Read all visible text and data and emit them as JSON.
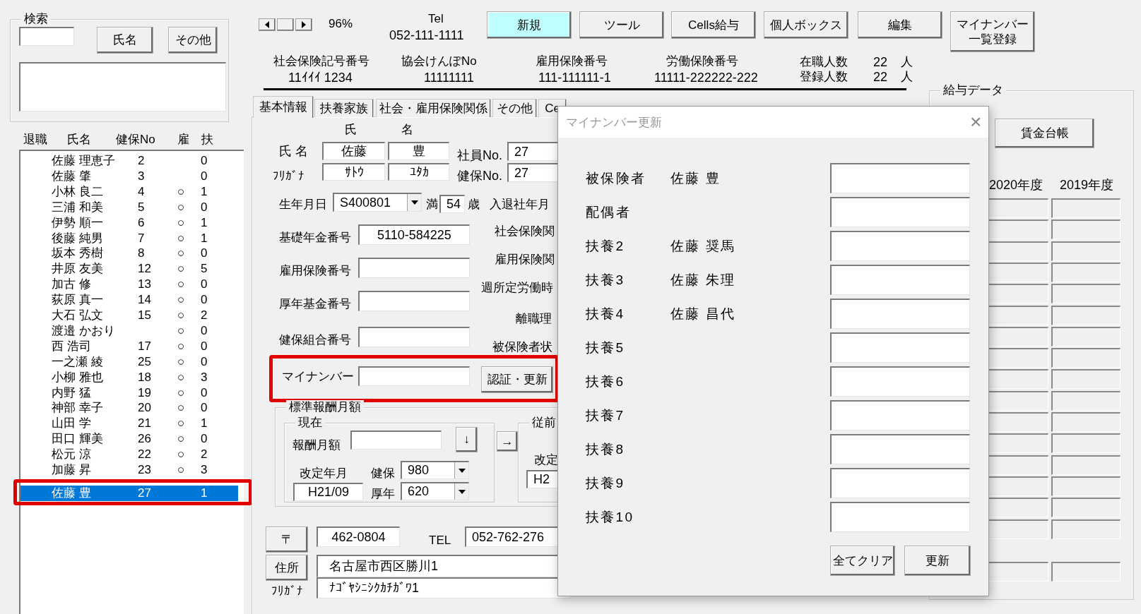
{
  "search": {
    "title": "検索",
    "buttons": [
      "氏名",
      "その他"
    ]
  },
  "employee_list": {
    "columns": [
      "退職",
      "氏名",
      "健保No",
      "雇",
      "扶"
    ],
    "rows": [
      {
        "name": "佐藤 理恵子",
        "kenpo_no": "2",
        "fuyo": "0",
        "selected": false
      },
      {
        "name": "佐藤 肇",
        "kenpo_no": "3",
        "fuyo": "0",
        "selected": false
      },
      {
        "name": "小林 良二",
        "kenpo_no": "4",
        "koyo": "○",
        "fuyo": "1",
        "selected": false
      },
      {
        "name": "三浦 和美",
        "kenpo_no": "5",
        "koyo": "○",
        "fuyo": "0",
        "selected": false
      },
      {
        "name": "伊勢 順一",
        "kenpo_no": "6",
        "koyo": "○",
        "fuyo": "1",
        "selected": false
      },
      {
        "name": "後藤 純男",
        "kenpo_no": "7",
        "koyo": "○",
        "fuyo": "1",
        "selected": false
      },
      {
        "name": "坂本 秀樹",
        "kenpo_no": "8",
        "koyo": "○",
        "fuyo": "0",
        "selected": false
      },
      {
        "name": "井原 友美",
        "kenpo_no": "12",
        "koyo": "○",
        "fuyo": "5",
        "selected": false
      },
      {
        "name": "加古 修",
        "kenpo_no": "13",
        "koyo": "○",
        "fuyo": "0",
        "selected": false
      },
      {
        "name": "荻原 真一",
        "kenpo_no": "14",
        "koyo": "○",
        "fuyo": "0",
        "selected": false
      },
      {
        "name": "大石 弘文",
        "kenpo_no": "15",
        "koyo": "○",
        "fuyo": "2",
        "selected": false
      },
      {
        "name": "渡邉 かおり",
        "koyo": "○",
        "fuyo": "0",
        "selected": false
      },
      {
        "name": "西 浩司",
        "kenpo_no": "17",
        "koyo": "○",
        "fuyo": "0",
        "selected": false
      },
      {
        "name": "一之瀬 綾",
        "kenpo_no": "25",
        "koyo": "○",
        "fuyo": "0",
        "selected": false
      },
      {
        "name": "小柳 雅也",
        "kenpo_no": "18",
        "koyo": "○",
        "fuyo": "3",
        "selected": false
      },
      {
        "name": "内野 猛",
        "kenpo_no": "19",
        "koyo": "○",
        "fuyo": "0",
        "selected": false
      },
      {
        "name": "神部 幸子",
        "kenpo_no": "20",
        "koyo": "○",
        "fuyo": "0",
        "selected": false
      },
      {
        "name": "山田 学",
        "kenpo_no": "21",
        "koyo": "○",
        "fuyo": "1",
        "selected": false
      },
      {
        "name": "田口 輝美",
        "kenpo_no": "26",
        "koyo": "○",
        "fuyo": "0",
        "selected": false
      },
      {
        "name": "松元 涼",
        "kenpo_no": "22",
        "koyo": "○",
        "fuyo": "2",
        "selected": false
      },
      {
        "name": "加藤 昇",
        "kenpo_no": "23",
        "koyo": "○",
        "fuyo": "3",
        "selected": false
      },
      {
        "name": "佐藤 豊",
        "kenpo_no": "27",
        "fuyo": "1",
        "selected": true
      }
    ]
  },
  "toolbar": {
    "zoom": "96%",
    "tel_label": "Tel",
    "tel": "052-111-1111",
    "buttons": [
      {
        "label": "新規",
        "highlighted": true
      },
      {
        "label": "ツール",
        "highlighted": false
      },
      {
        "label": "Cells給与",
        "highlighted": false
      },
      {
        "label": "個人ボックス",
        "highlighted": false
      },
      {
        "label": "編集",
        "highlighted": false
      },
      {
        "lines": [
          "マイナンバー",
          "一覧登録"
        ],
        "highlighted": false
      }
    ]
  },
  "insurance_info": [
    {
      "label": "社会保険記号番号",
      "value": "11ｲｲｲ 1234"
    },
    {
      "label": "協会けんぽNo",
      "value": "11111111"
    },
    {
      "label": "雇用保険番号",
      "value": "111-111111-1"
    },
    {
      "label": "労働保険番号",
      "value": "11111-222222-222"
    }
  ],
  "staff_counts": [
    {
      "label": "在職人数",
      "value": "22",
      "unit": "人"
    },
    {
      "label": "登録人数",
      "value": "22",
      "unit": "人"
    }
  ],
  "tabs": [
    {
      "label": "基本情報",
      "selected": true
    },
    {
      "label": "扶養家族",
      "selected": false
    },
    {
      "label": "社会・雇用保険関係",
      "selected": false
    },
    {
      "label": "その他",
      "selected": false
    },
    {
      "label": "Ce",
      "selected": false
    }
  ],
  "basic_info": {
    "name_headers": [
      "氏",
      "名"
    ],
    "name_label": "氏 名",
    "surname": "佐藤",
    "given_name": "豊",
    "furigana_label": "ﾌﾘｶﾞﾅ",
    "furigana_surname": "ｻﾄｳ",
    "furigana_given": "ﾕﾀｶ",
    "employee_no_label": "社員No.",
    "employee_no": "27",
    "kenpo_no_label": "健保No.",
    "kenpo_no": "27",
    "birth_label": "生年月日",
    "birth": "S400801",
    "age_prefix": "満",
    "age": "54",
    "age_suffix": "歳",
    "fields": [
      {
        "label": "基礎年金番号",
        "value": "5110-584225"
      },
      {
        "label": "雇用保険番号"
      },
      {
        "label": "厚年基金番号"
      },
      {
        "label": "健保組合番号"
      }
    ],
    "side_labels": [
      "入退社年月",
      "社会保険関",
      "雇用保険関",
      "週所定労働時",
      "離職理",
      "被保険者状"
    ],
    "my_number": {
      "label": "マイナンバー",
      "button": "認証・更新"
    },
    "standard_remuneration": {
      "title": "標準報酬月額",
      "current_title": "現在",
      "amount_label": "報酬月額",
      "down_button": "↓",
      "copy_button": "→",
      "revision_label": "改定年月",
      "revision": "H21/09",
      "kenpo_label": "健保",
      "kenpo": "980",
      "kounen_label": "厚年",
      "kounen": "620",
      "previous_title": "従前",
      "previous_revision_label": "改定",
      "previous_revision": "H2"
    },
    "address": {
      "postal_button": "〒",
      "postal": "462-0804",
      "tel_label": "TEL",
      "tel": "052-762-276",
      "address_button": "住所",
      "address": "名古屋市西区勝川1",
      "furigana_label": "ﾌﾘｶﾞﾅ",
      "furigana": "ﾅｺﾞﾔｼﾆｼｸｶﾁｶﾞﾜ1"
    }
  },
  "salary_data": {
    "title": "給与データ",
    "button": "賃金台帳",
    "year_headers": [
      "2020年度",
      "2019年度"
    ]
  },
  "dialog": {
    "title": "マイナンバー更新",
    "close": "×",
    "rows": [
      {
        "label": "被保険者",
        "name": "佐藤 豊"
      },
      {
        "label": "配偶者"
      },
      {
        "label": "扶養2",
        "name": "佐藤 奨馬"
      },
      {
        "label": "扶養3",
        "name": "佐藤 朱理"
      },
      {
        "label": "扶養4",
        "name": "佐藤 昌代"
      },
      {
        "label": "扶養5"
      },
      {
        "label": "扶養6"
      },
      {
        "label": "扶養7"
      },
      {
        "label": "扶養8"
      },
      {
        "label": "扶養9"
      },
      {
        "label": "扶養10"
      }
    ],
    "buttons": [
      "全てクリア",
      "更新"
    ]
  }
}
